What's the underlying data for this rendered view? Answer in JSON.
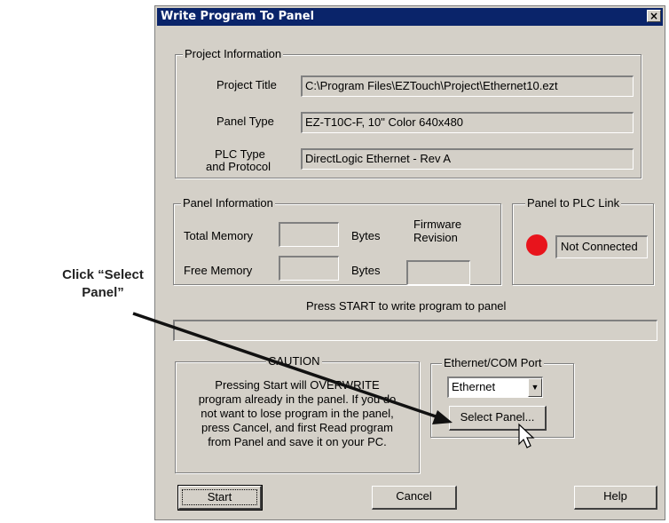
{
  "annotation": {
    "callout_line1": "Click “Select",
    "callout_line2": "Panel”"
  },
  "window": {
    "title": "Write Program To Panel",
    "close_glyph": "×"
  },
  "project_info": {
    "legend": "Project Information",
    "project_title_label": "Project Title",
    "project_title_value": "C:\\Program Files\\EZTouch\\Project\\Ethernet10.ezt",
    "panel_type_label": "Panel Type",
    "panel_type_value": "EZ-T10C-F, 10\" Color 640x480",
    "plc_type_label_line1": "PLC Type",
    "plc_type_label_line2": "and Protocol",
    "plc_type_value": "DirectLogic  Ethernet - Rev A"
  },
  "panel_info": {
    "legend": "Panel Information",
    "total_memory_label": "Total Memory",
    "total_memory_value": "",
    "free_memory_label": "Free Memory",
    "free_memory_value": "",
    "bytes_label": "Bytes",
    "firmware_label_line1": "Firmware",
    "firmware_label_line2": "Revision",
    "firmware_value": ""
  },
  "plc_link": {
    "legend": "Panel to PLC Link",
    "status_text": "Not Connected",
    "status_color": "#e8141c"
  },
  "progress": {
    "message": "Press START to write program to panel",
    "value": 0
  },
  "caution": {
    "legend": "CAUTION",
    "line1": "Pressing Start will OVERWRITE",
    "line2": "program already in the panel. If you do",
    "line3": "not want to lose program in the panel,",
    "line4": "press Cancel, and first Read program",
    "line5": "from Panel and save it on your PC."
  },
  "port": {
    "legend": "Ethernet/COM Port",
    "selected": "Ethernet",
    "select_panel_label": "Select Panel..."
  },
  "buttons": {
    "start": "Start",
    "cancel": "Cancel",
    "help": "Help"
  }
}
